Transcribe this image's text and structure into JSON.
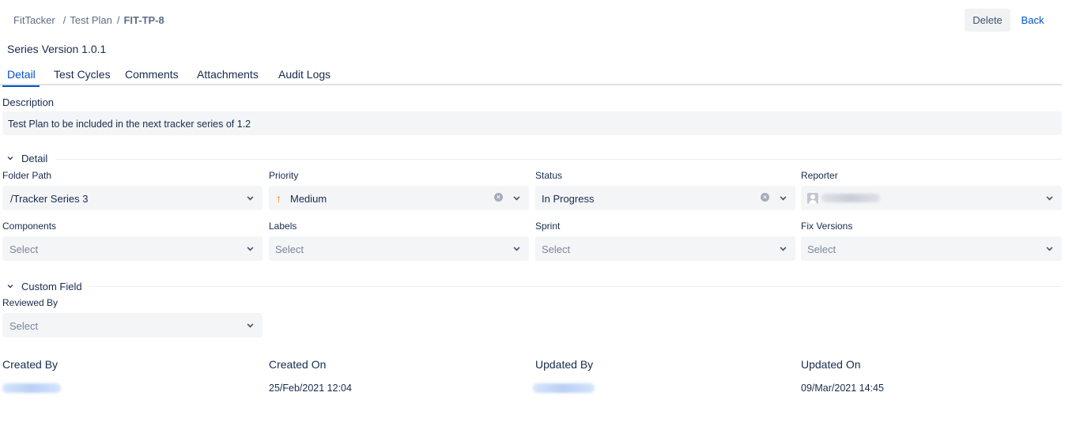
{
  "breadcrumb": {
    "project": "FitTacker",
    "section": "Test Plan",
    "current": "FIT-TP-8",
    "separator": "/"
  },
  "toolbar": {
    "delete_label": "Delete",
    "back_label": "Back"
  },
  "page_title": "Series Version 1.0.1",
  "tabs": [
    {
      "label": "Detail",
      "active": true
    },
    {
      "label": "Test Cycles",
      "active": false
    },
    {
      "label": "Comments",
      "active": false
    },
    {
      "label": "Attachments",
      "active": false
    },
    {
      "label": "Audit Logs",
      "active": false
    }
  ],
  "description": {
    "label": "Description",
    "value": "Test Plan to be included in the next tracker series of 1.2"
  },
  "detail_section": {
    "title": "Detail",
    "fields": {
      "folder_path": {
        "label": "Folder Path",
        "value": "/Tracker Series 3"
      },
      "priority": {
        "label": "Priority",
        "value": "Medium",
        "icon": "arrow-up-icon",
        "icon_color": "#ff7a00"
      },
      "status": {
        "label": "Status",
        "value": "In Progress"
      },
      "reporter": {
        "label": "Reporter",
        "icon": "user-avatar-icon"
      },
      "components": {
        "label": "Components",
        "placeholder": "Select"
      },
      "labels": {
        "label": "Labels",
        "placeholder": "Select"
      },
      "sprint": {
        "label": "Sprint",
        "placeholder": "Select"
      },
      "fix_versions": {
        "label": "Fix Versions",
        "placeholder": "Select"
      }
    }
  },
  "custom_section": {
    "title": "Custom Field",
    "fields": {
      "reviewed_by": {
        "label": "Reviewed By",
        "placeholder": "Select"
      }
    }
  },
  "meta": {
    "created_by": {
      "label": "Created By"
    },
    "created_on": {
      "label": "Created On",
      "value": "25/Feb/2021 12:04"
    },
    "updated_by": {
      "label": "Updated By"
    },
    "updated_on": {
      "label": "Updated On",
      "value": "09/Mar/2021 14:45"
    }
  },
  "colors": {
    "accent": "#0052cc",
    "text": "#172b4d",
    "field_bg": "#f4f5f7"
  }
}
